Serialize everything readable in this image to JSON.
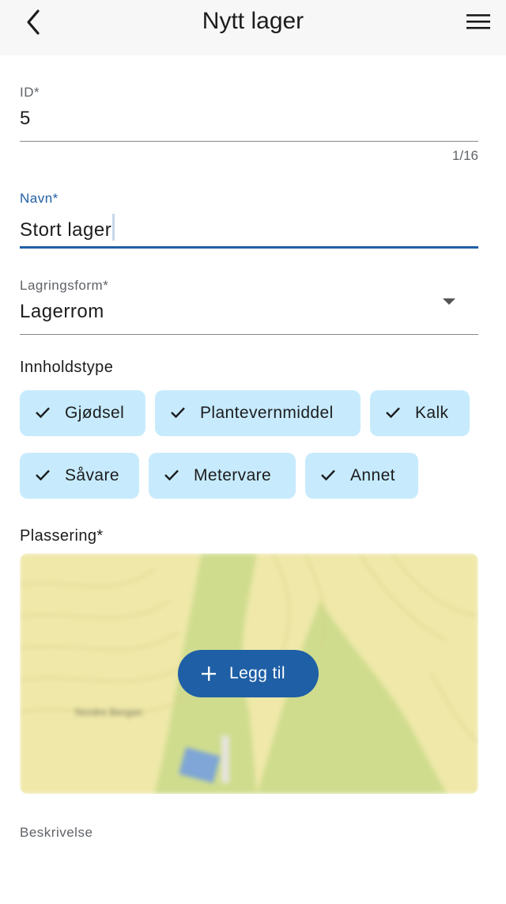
{
  "header": {
    "title": "Nytt lager",
    "back_icon": "chevron-left-icon",
    "menu_icon": "hamburger-menu-icon"
  },
  "form": {
    "id": {
      "label": "ID*",
      "value": "5",
      "counter": "1/16"
    },
    "name": {
      "label": "Navn*",
      "value": "Stort lager"
    },
    "storage_form": {
      "label": "Lagringsform*",
      "value": "Lagerrom",
      "arrow_icon": "dropdown-arrow-icon"
    },
    "content_type": {
      "label": "Innholdstype",
      "chips": [
        {
          "label": "Gjødsel",
          "selected": true
        },
        {
          "label": "Plantevernmiddel",
          "selected": true
        },
        {
          "label": "Kalk",
          "selected": true
        },
        {
          "label": "Såvare",
          "selected": true
        },
        {
          "label": "Metervare",
          "selected": true
        },
        {
          "label": "Annet",
          "selected": true
        }
      ]
    },
    "location": {
      "label": "Plassering*",
      "map_place_label": "Nordre Bergan",
      "add_button_label": "Legg til",
      "add_icon": "plus-icon"
    },
    "description": {
      "label": "Beskrivelse"
    }
  },
  "colors": {
    "accent": "#1f5fa6",
    "chip_bg": "#c7ebfd",
    "header_bg": "#f7f7f7",
    "map_base": "#efe8a8",
    "map_green": "#cfdc8e"
  }
}
